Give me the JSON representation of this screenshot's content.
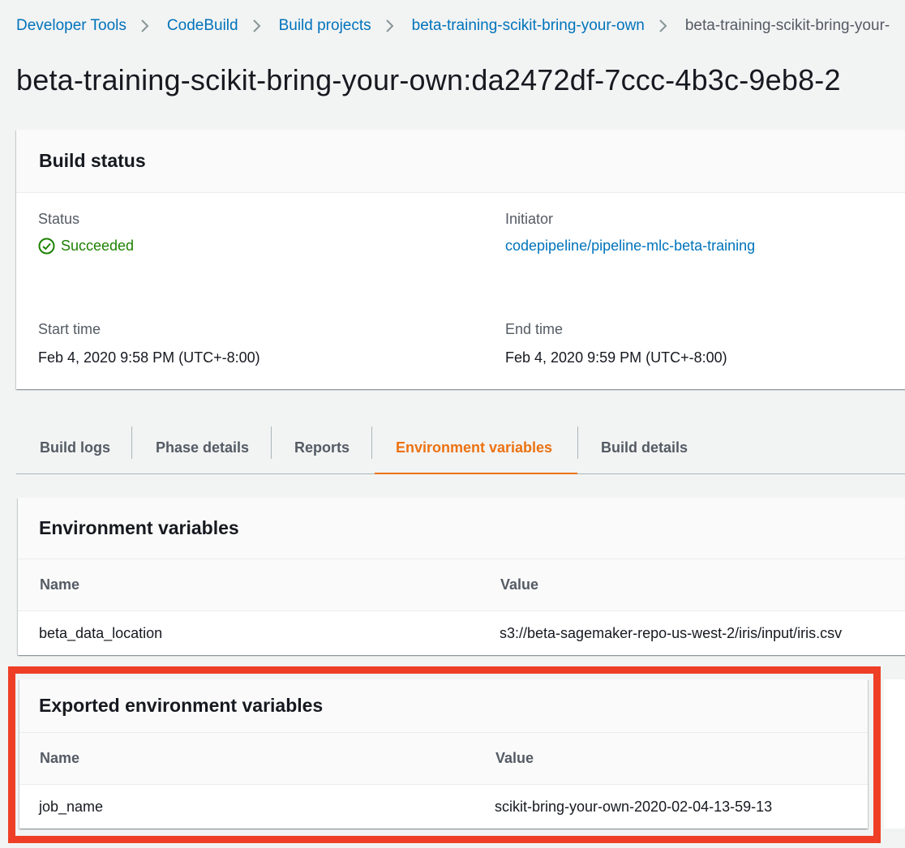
{
  "breadcrumb": {
    "items": [
      "Developer Tools",
      "CodeBuild",
      "Build projects",
      "beta-training-scikit-bring-your-own"
    ],
    "current": "beta-training-scikit-bring-your-"
  },
  "page": {
    "title": "beta-training-scikit-bring-your-own:da2472df-7ccc-4b3c-9eb8-2"
  },
  "build_status": {
    "header": "Build status",
    "status_label": "Status",
    "status_value": "Succeeded",
    "initiator_label": "Initiator",
    "initiator_value": "codepipeline/pipeline-mlc-beta-training",
    "start_label": "Start time",
    "start_value": "Feb 4, 2020 9:58 PM (UTC+-8:00)",
    "end_label": "End time",
    "end_value": "Feb 4, 2020 9:59 PM (UTC+-8:00)"
  },
  "tabs": [
    "Build logs",
    "Phase details",
    "Reports",
    "Environment variables",
    "Build details"
  ],
  "active_tab": "Environment variables",
  "env_vars": {
    "header": "Environment variables",
    "columns": [
      "Name",
      "Value"
    ],
    "rows": [
      {
        "name": "beta_data_location",
        "value": "s3://beta-sagemaker-repo-us-west-2/iris/input/iris.csv"
      }
    ]
  },
  "exported_env_vars": {
    "header": "Exported environment variables",
    "columns": [
      "Name",
      "Value"
    ],
    "rows": [
      {
        "name": "job_name",
        "value": "scikit-bring-your-own-2020-02-04-13-59-13"
      }
    ]
  },
  "colors": {
    "link": "#0073bb",
    "success": "#1d8102",
    "active_tab": "#ec7211",
    "highlight": "#ee3f26"
  },
  "icons": {
    "breadcrumb_separator": "chevron-right-icon",
    "status": "check-circle-icon"
  }
}
